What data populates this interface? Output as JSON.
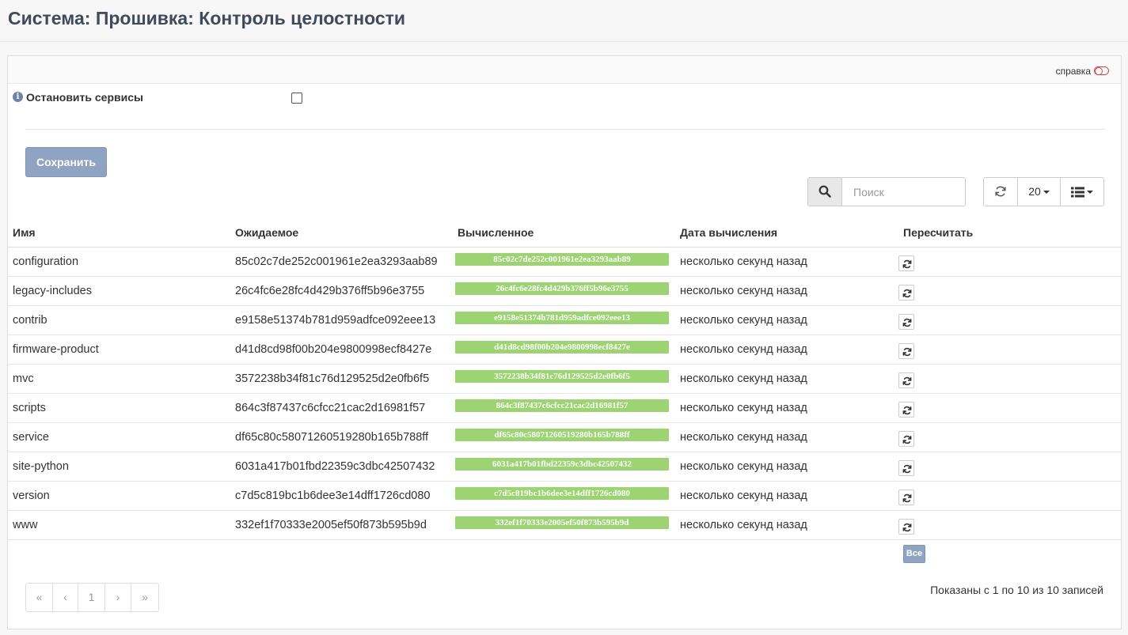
{
  "page": {
    "title": "Система: Прошивка: Контроль целостности"
  },
  "help": {
    "label": "справка"
  },
  "form": {
    "stop_services_label": "Остановить сервисы",
    "stop_services_checked": false,
    "save_label": "Сохранить"
  },
  "toolbar": {
    "search_placeholder": "Поиск",
    "search_value": "",
    "page_size": "20"
  },
  "table": {
    "columns": [
      "Имя",
      "Ожидаемое",
      "Вычисленное",
      "Дата вычисления",
      "Пересчитать"
    ],
    "rows": [
      {
        "name": "configuration",
        "expected": "85c02c7de252c001961e2ea3293aab89",
        "computed": "85c02c7de252c001961e2ea3293aab89",
        "date": "несколько секунд назад"
      },
      {
        "name": "legacy-includes",
        "expected": "26c4fc6e28fc4d429b376ff5b96e3755",
        "computed": "26c4fc6e28fc4d429b376ff5b96e3755",
        "date": "несколько секунд назад"
      },
      {
        "name": "contrib",
        "expected": "e9158e51374b781d959adfce092eee13",
        "computed": "e9158e51374b781d959adfce092eee13",
        "date": "несколько секунд назад"
      },
      {
        "name": "firmware-product",
        "expected": "d41d8cd98f00b204e9800998ecf8427e",
        "computed": "d41d8cd98f00b204e9800998ecf8427e",
        "date": "несколько секунд назад"
      },
      {
        "name": "mvc",
        "expected": "3572238b34f81c76d129525d2e0fb6f5",
        "computed": "3572238b34f81c76d129525d2e0fb6f5",
        "date": "несколько секунд назад"
      },
      {
        "name": "scripts",
        "expected": "864c3f87437c6cfcc21cac2d16981f57",
        "computed": "864c3f87437c6cfcc21cac2d16981f57",
        "date": "несколько секунд назад"
      },
      {
        "name": "service",
        "expected": "df65c80c58071260519280b165b788ff",
        "computed": "df65c80c58071260519280b165b788ff",
        "date": "несколько секунд назад"
      },
      {
        "name": "site-python",
        "expected": "6031a417b01fbd22359c3dbc42507432",
        "computed": "6031a417b01fbd22359c3dbc42507432",
        "date": "несколько секунд назад"
      },
      {
        "name": "version",
        "expected": "c7d5c819bc1b6dee3e14dff1726cd080",
        "computed": "c7d5c819bc1b6dee3e14dff1726cd080",
        "date": "несколько секунд назад"
      },
      {
        "name": "www",
        "expected": "332ef1f70333e2005ef50f873b595b9d",
        "computed": "332ef1f70333e2005ef50f873b595b9d",
        "date": "несколько секунд назад"
      }
    ],
    "all_label": "Все"
  },
  "pagination": {
    "first": "«",
    "prev": "‹",
    "current": "1",
    "next": "›",
    "last": "»",
    "summary": "Показаны с 1 по 10 из 10 записей"
  },
  "colors": {
    "match_badge": "#9cd472",
    "primary_button": "#8fa3c2",
    "title": "#3f4a5a",
    "help_toggle": "#e04040"
  },
  "icons": {
    "info": "info-icon",
    "help_toggle": "toggle-icon",
    "search": "search-icon",
    "refresh": "refresh-icon",
    "columns": "list-columns-icon",
    "recalc": "recalc-icon"
  }
}
